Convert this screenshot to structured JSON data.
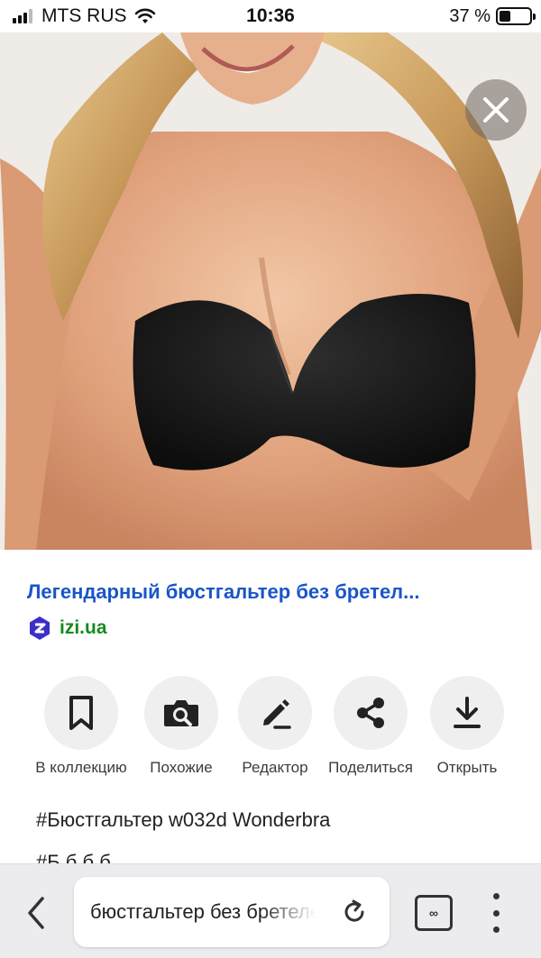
{
  "status_bar": {
    "carrier": "MTS RUS",
    "time": "10:36",
    "battery_percent": "37 %",
    "battery_level": 0.37
  },
  "image_viewer": {
    "close_icon": "close-icon"
  },
  "result": {
    "title": "Легендарный бюстгальтер без бретел...",
    "source_name": "izi.ua",
    "title_color": "#1a55c9",
    "source_color": "#18891f"
  },
  "actions": [
    {
      "label": "В коллекцию",
      "icon": "bookmark-icon"
    },
    {
      "label": "Похожие",
      "icon": "camera-search-icon"
    },
    {
      "label": "Редактор",
      "icon": "pencil-icon"
    },
    {
      "label": "Поделиться",
      "icon": "share-icon"
    },
    {
      "label": "Открыть",
      "icon": "download-icon"
    }
  ],
  "tags": {
    "line1": "#Бюстгальтер w032d Wonderbra",
    "line2": "#Б                    б        б    б"
  },
  "browser": {
    "address_text": "бюстгальтер без бретелей",
    "tabs_label": "∞"
  }
}
